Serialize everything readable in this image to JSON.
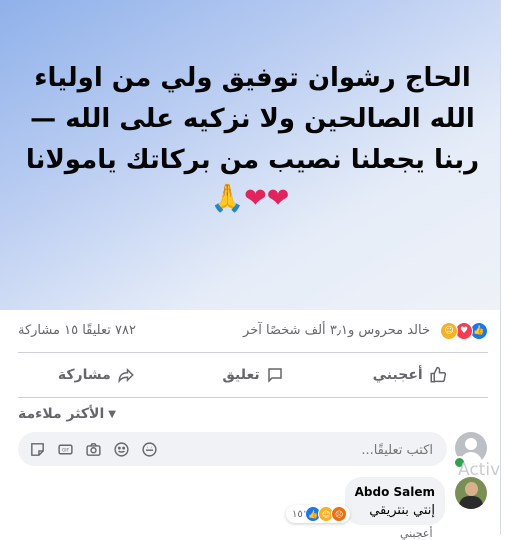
{
  "post": {
    "lines": [
      "الحاج رشوان توفيق ولي من اولياء",
      "الله الصالحين ولا نزكيه على الله —",
      "ربنا يجعلنا نصيب من بركاتك يامولانا"
    ],
    "emoji_line": "🙏❤❤",
    "banner_colors": {
      "start": "#8fb1ea",
      "end": "#eef1f7"
    }
  },
  "stats": {
    "reaction_icons": [
      "like-icon",
      "love-icon",
      "care-icon"
    ],
    "reactors": "خالد محروس و٣٫١ ألف شخصًا آخر",
    "comments": "٧٨٢ تعليقًا",
    "shares": "١٥ مشاركة"
  },
  "actions": {
    "like": "أعجبني",
    "comment": "تعليق",
    "share": "مشاركة"
  },
  "filter": {
    "label": "الأكثر ملاءمة"
  },
  "composer": {
    "placeholder": "اكتب تعليقًا...",
    "icons": [
      "sticker-icon",
      "gif-icon",
      "camera-icon",
      "emoji-icon",
      "avatar-sticker-icon"
    ]
  },
  "comment": {
    "author": "Abdo Salem",
    "text": "إنتي بنتريقي",
    "reaction_icons": [
      "like-icon",
      "haha-icon",
      "angry-icon"
    ],
    "reaction_count": "١٥١",
    "next_hint": "أعجبني"
  },
  "overlay": {
    "text": "Activ"
  },
  "colors": {
    "accent": "#1877f2",
    "text_secondary": "#65676b",
    "love": "#f33e58"
  }
}
